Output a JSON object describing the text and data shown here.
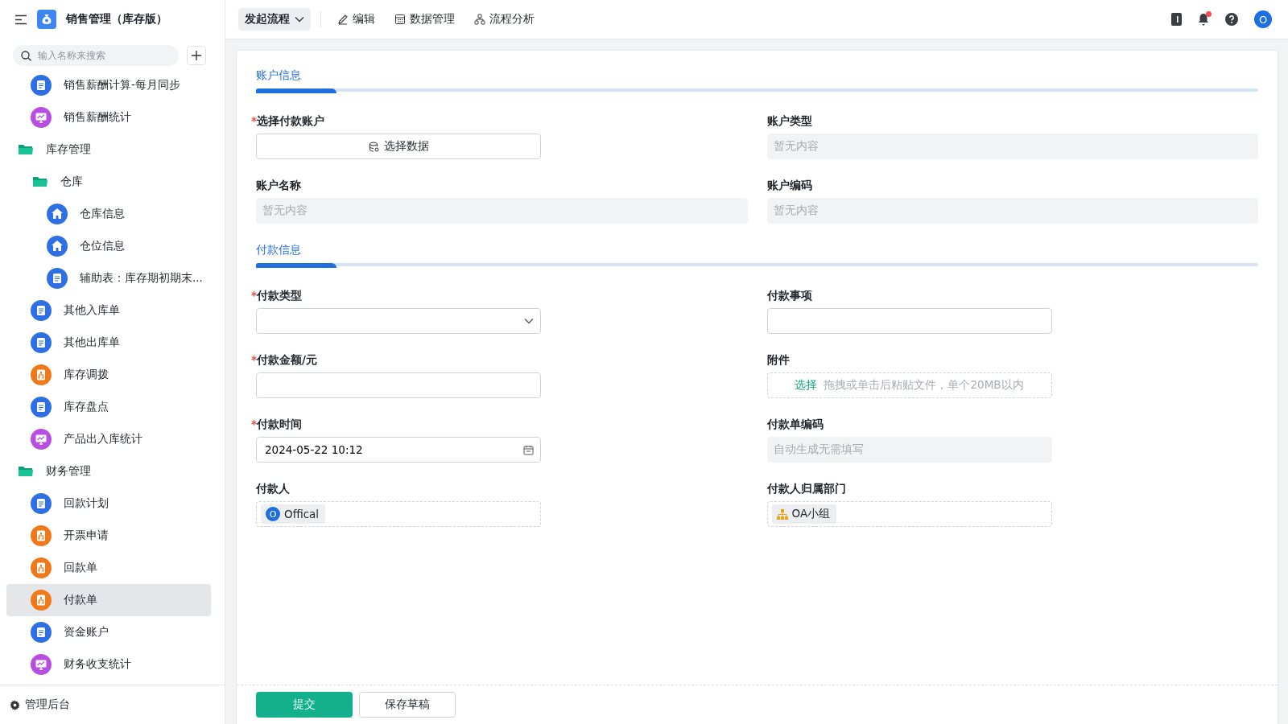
{
  "app": {
    "title": "销售管理（库存版）"
  },
  "sidebar": {
    "search": {
      "placeholder": "输入名称来搜索"
    },
    "items": [
      {
        "kind": "form",
        "label": "销售薪酬计算-每月同步",
        "selected": false
      },
      {
        "kind": "report",
        "label": "销售薪酬统计",
        "selected": false
      },
      {
        "kind": "folder",
        "label": "库存管理",
        "selected": false,
        "children": [
          {
            "kind": "folder",
            "label": "仓库",
            "selected": false,
            "children": [
              {
                "kind": "home",
                "label": "仓库信息",
                "selected": false
              },
              {
                "kind": "home",
                "label": "仓位信息",
                "selected": false
              },
              {
                "kind": "form",
                "label": "辅助表：库存期初期末...",
                "selected": false
              }
            ]
          },
          {
            "kind": "form",
            "label": "其他入库单",
            "selected": false
          },
          {
            "kind": "form",
            "label": "其他出库单",
            "selected": false
          },
          {
            "kind": "flow",
            "label": "库存调拨",
            "selected": false
          },
          {
            "kind": "form",
            "label": "库存盘点",
            "selected": false
          },
          {
            "kind": "report",
            "label": "产品出入库统计",
            "selected": false
          }
        ]
      },
      {
        "kind": "folder",
        "label": "财务管理",
        "selected": false,
        "children": [
          {
            "kind": "form",
            "label": "回款计划",
            "selected": false
          },
          {
            "kind": "flow",
            "label": "开票申请",
            "selected": false
          },
          {
            "kind": "flow",
            "label": "回款单",
            "selected": false
          },
          {
            "kind": "flow",
            "label": "付款单",
            "selected": true
          },
          {
            "kind": "form",
            "label": "资金账户",
            "selected": false
          },
          {
            "kind": "report",
            "label": "财务收支统计",
            "selected": false
          }
        ]
      }
    ],
    "footer": "管理后台"
  },
  "toolbar": {
    "start": "发起流程",
    "actions": [
      {
        "kind": "edit",
        "label": "编辑"
      },
      {
        "kind": "data",
        "label": "数据管理"
      },
      {
        "kind": "flow",
        "label": "流程分析"
      }
    ],
    "notification": true,
    "avatar": "O"
  },
  "sections": [
    {
      "title": "账户信息",
      "fields": [
        {
          "kind": "picker",
          "label": "选择付款账户",
          "required": true,
          "required_mark": "*",
          "value": "选择数据"
        },
        {
          "kind": "display",
          "label": "账户类型",
          "required": false,
          "placeholder": "暂无内容"
        },
        {
          "kind": "display",
          "label": "账户名称",
          "required": false,
          "placeholder": "暂无内容"
        },
        {
          "kind": "display",
          "label": "账户编码",
          "required": false,
          "placeholder": "暂无内容"
        }
      ]
    },
    {
      "title": "付款信息",
      "fields": [
        {
          "kind": "select",
          "label": "付款类型",
          "required": true,
          "required_mark": "*"
        },
        {
          "kind": "input",
          "label": "付款事项",
          "required": false
        },
        {
          "kind": "input",
          "label": "付款金额/元",
          "required": true,
          "required_mark": "*"
        },
        {
          "kind": "upload",
          "label": "附件",
          "required": false,
          "action": "选择",
          "hint": "拖拽或单击后粘贴文件，单个20MB以内"
        },
        {
          "kind": "datetime",
          "label": "付款时间",
          "required": true,
          "required_mark": "*",
          "value": "2024-05-22 10:12"
        },
        {
          "kind": "auto",
          "label": "付款单编码",
          "required": false,
          "placeholder": "自动生成无需填写"
        },
        {
          "kind": "member",
          "label": "付款人",
          "required": false,
          "value": "Offical",
          "initial": "O"
        },
        {
          "kind": "dept",
          "label": "付款人归属部门",
          "required": false,
          "value": "OA小组"
        }
      ]
    }
  ],
  "buttons": {
    "submit": "提交",
    "draft": "保存草稿"
  }
}
